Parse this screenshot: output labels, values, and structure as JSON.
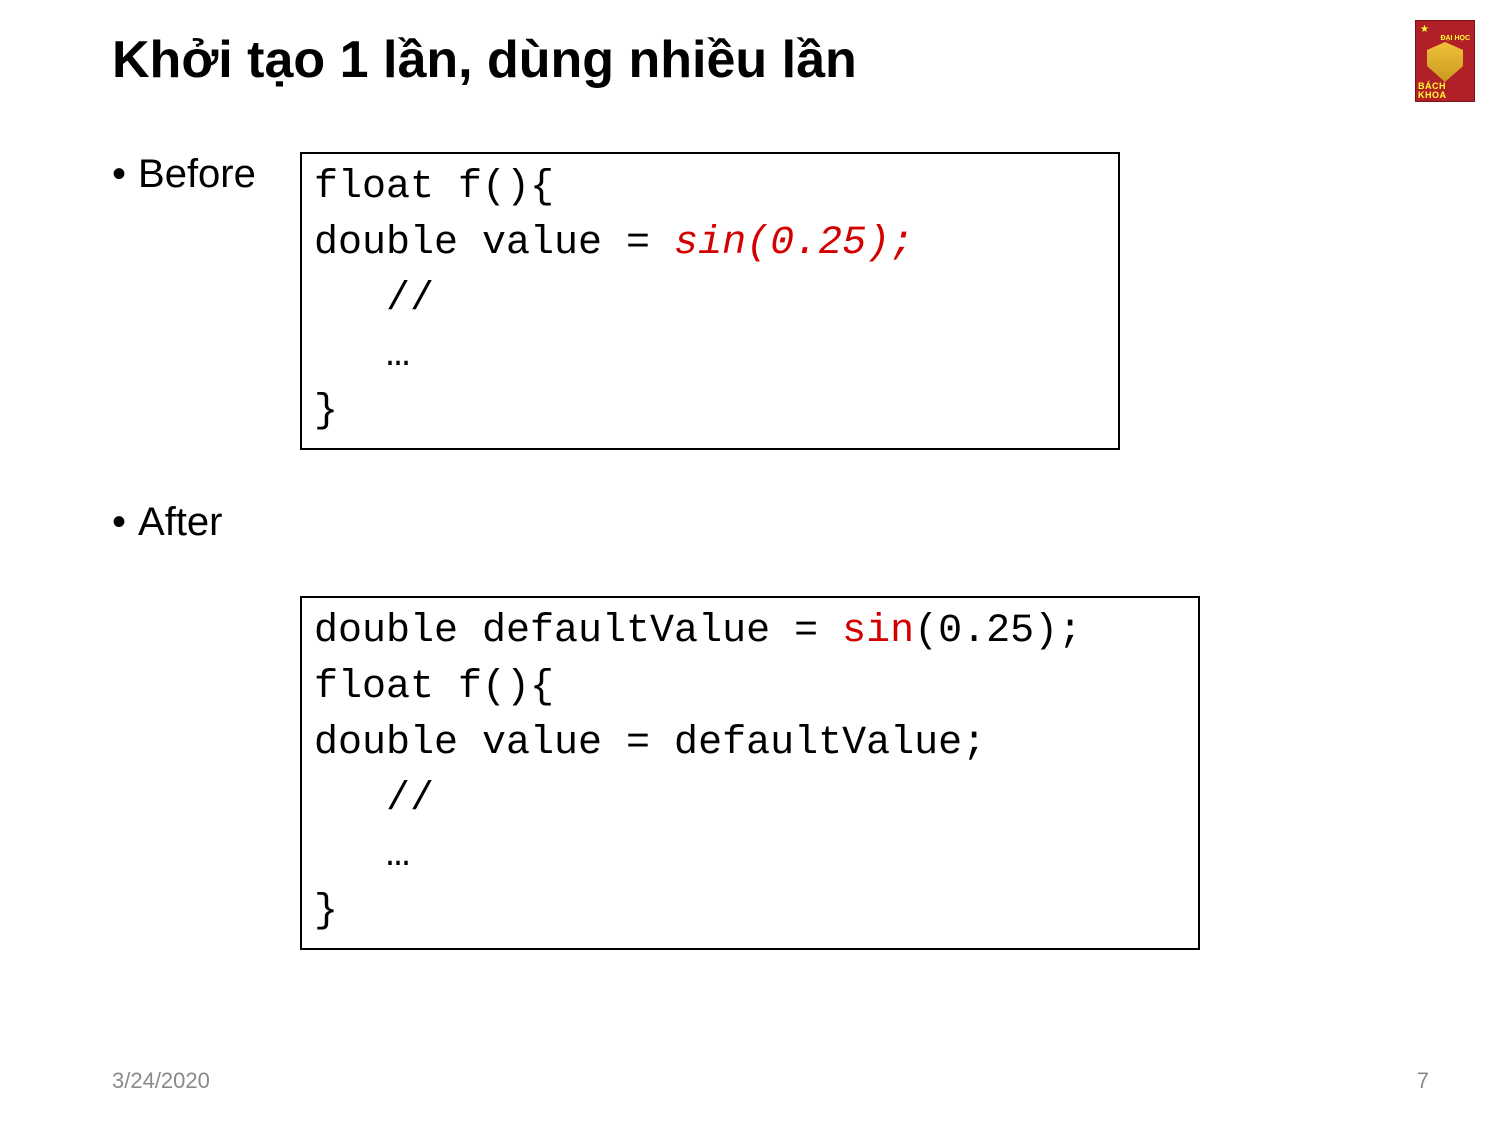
{
  "title": "Khởi tạo 1 lần, dùng nhiều lần",
  "logo": {
    "top_text": "ĐẠI HỌC",
    "bottom_text": "BÁCH KHOA"
  },
  "bullets": {
    "before": "Before",
    "after": "After"
  },
  "code_before": {
    "l1": "float f(){",
    "l2a": "double value = ",
    "l2b": "sin(0.25);",
    "l3": "   //",
    "l4": "   …",
    "l5": "}"
  },
  "code_after": {
    "l1a": "double defaultValue = ",
    "l1b": "sin",
    "l1c": "(0.25);",
    "l2": "float f(){",
    "l3": "double value = defaultValue;",
    "l4": "   //",
    "l5": "   …",
    "l6": "}"
  },
  "footer": {
    "date": "3/24/2020",
    "page": "7"
  }
}
